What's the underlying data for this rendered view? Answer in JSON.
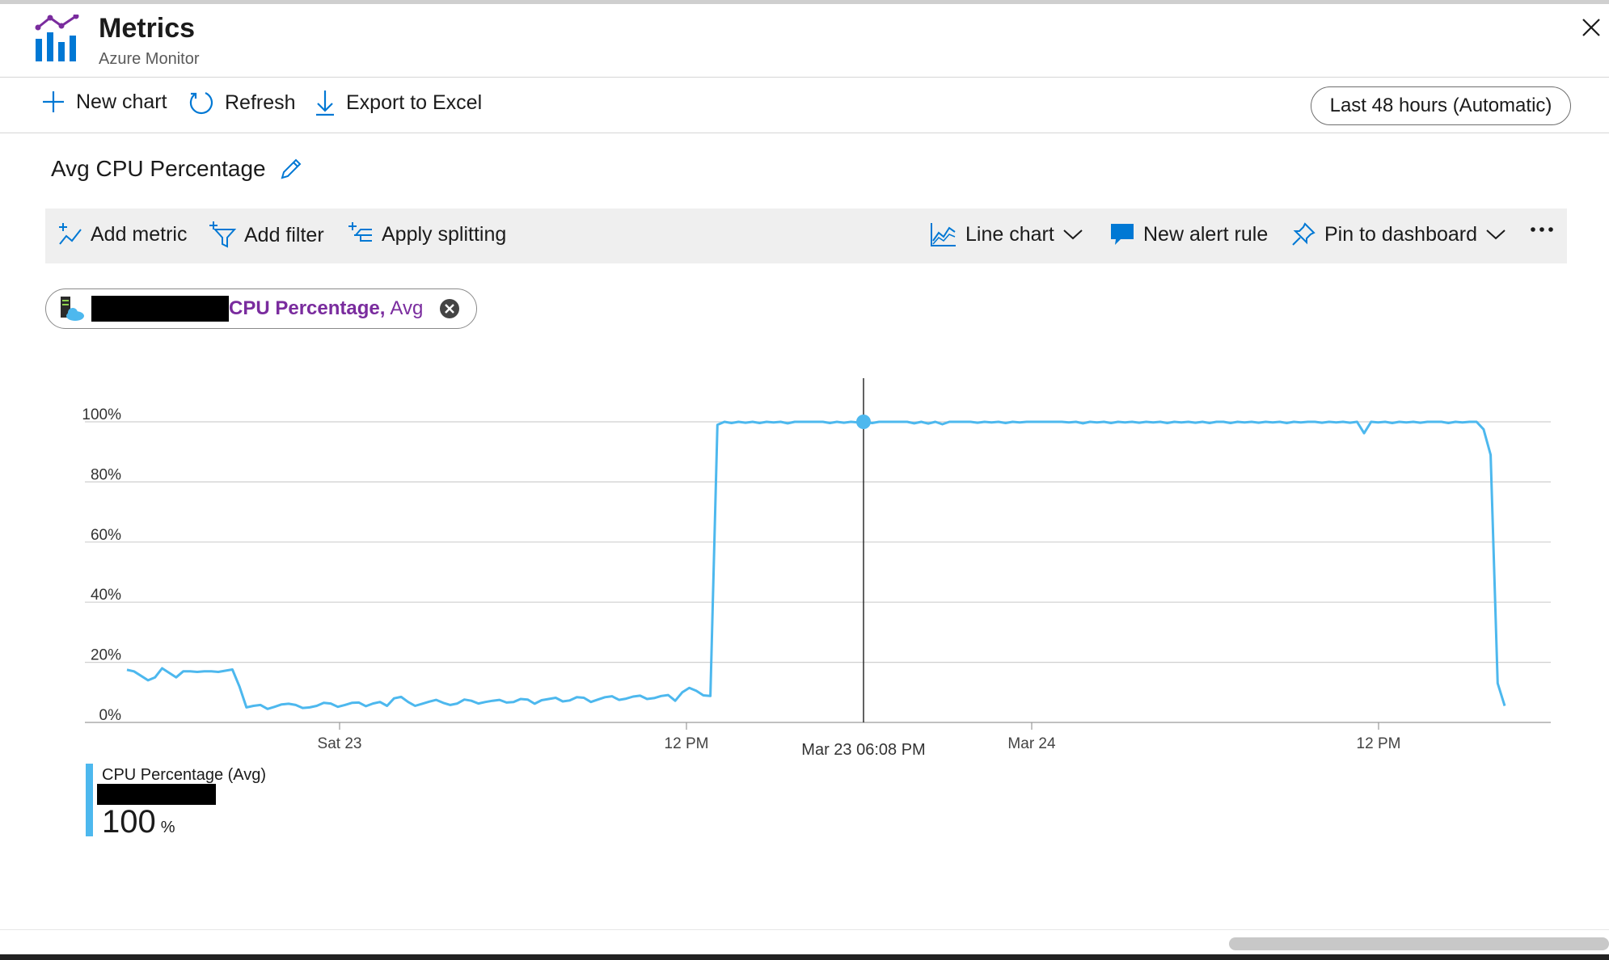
{
  "header": {
    "title": "Metrics",
    "subtitle": "Azure Monitor",
    "close_icon": "close-icon"
  },
  "commands": {
    "new_chart": "New chart",
    "refresh": "Refresh",
    "export": "Export to Excel",
    "time_range": "Last 48 hours (Automatic)"
  },
  "chart_title": "Avg CPU Percentage",
  "toolbar": {
    "add_metric": "Add metric",
    "add_filter": "Add filter",
    "apply_splitting": "Apply splitting",
    "line_chart": "Line chart",
    "new_alert_rule": "New alert rule",
    "pin_to_dashboard": "Pin to dashboard",
    "more": "..."
  },
  "metric_pill": {
    "metric": "CPU Percentage,",
    "aggregation": "Avg"
  },
  "legend": {
    "label": "CPU Percentage (Avg)",
    "value": "100",
    "unit": "%"
  },
  "colors": {
    "series": "#4db8ee",
    "metric_text": "#7a2c9e",
    "accent": "#0078d4"
  },
  "chart_data": {
    "type": "line",
    "y_tick_labels": [
      "0%",
      "20%",
      "40%",
      "60%",
      "80%",
      "100%"
    ],
    "y_tick_values": [
      0,
      20,
      40,
      60,
      80,
      100
    ],
    "ylim": [
      0,
      100
    ],
    "x_tick_labels": [
      "Sat 23",
      "12 PM",
      "Mar 24",
      "12 PM"
    ],
    "cursor_label": "Mar 23 06:08 PM",
    "grid": true,
    "series": [
      {
        "name": "CPU Percentage (Avg)",
        "unit": "%",
        "values": [
          17.5,
          17,
          15.5,
          14,
          15,
          18,
          16.5,
          15,
          17,
          17,
          16.8,
          17,
          17,
          16.8,
          17.2,
          17.6,
          12,
          5,
          5.5,
          5.8,
          4.5,
          5.2,
          6,
          6.2,
          5.8,
          4.8,
          5,
          5.5,
          6.5,
          6.3,
          5.2,
          5.8,
          6.5,
          6.6,
          5.4,
          6.3,
          6.8,
          5.5,
          8,
          8.5,
          6.8,
          5.5,
          6.2,
          6.9,
          7.5,
          6.5,
          5.8,
          6.3,
          7.6,
          7.2,
          6.3,
          6.8,
          7.2,
          7.5,
          6.6,
          6.8,
          7.8,
          7.6,
          6.2,
          7.4,
          7.8,
          8.2,
          7,
          7.3,
          8.4,
          8.2,
          6.8,
          7.6,
          8.4,
          8.7,
          7.5,
          7.9,
          8.6,
          8.9,
          7.8,
          8.1,
          8.8,
          9.1,
          7.2,
          10,
          11.5,
          10.5,
          9,
          8.8,
          99,
          100,
          99.6,
          100,
          99.7,
          100,
          99.6,
          100,
          99.8,
          100,
          99.5,
          100,
          100,
          100,
          100,
          100,
          99.6,
          100,
          99.7,
          100,
          99.8,
          100,
          99.6,
          100,
          100,
          100,
          100,
          100,
          99.5,
          100,
          99.4,
          100,
          99.2,
          100,
          100,
          100,
          100,
          99.7,
          100,
          99.8,
          100,
          99.6,
          100,
          99.8,
          100,
          100,
          100,
          100,
          100,
          100,
          99.8,
          100,
          99.5,
          100,
          99.8,
          100,
          99.6,
          100,
          99.8,
          100,
          99.7,
          100,
          99.8,
          100,
          99.6,
          100,
          99.8,
          100,
          99.7,
          100,
          99.6,
          100,
          100,
          99.6,
          100,
          99.8,
          100,
          99.7,
          100,
          99.8,
          100,
          99.6,
          100,
          99.8,
          100,
          100,
          99.7,
          100,
          99.8,
          100,
          99.7,
          100,
          96.2,
          100,
          99.8,
          100,
          99.6,
          100,
          99.8,
          100,
          99.7,
          100,
          100,
          100,
          99.6,
          100,
          99.8,
          100,
          100,
          97.5,
          89,
          13,
          5.5
        ]
      }
    ]
  }
}
